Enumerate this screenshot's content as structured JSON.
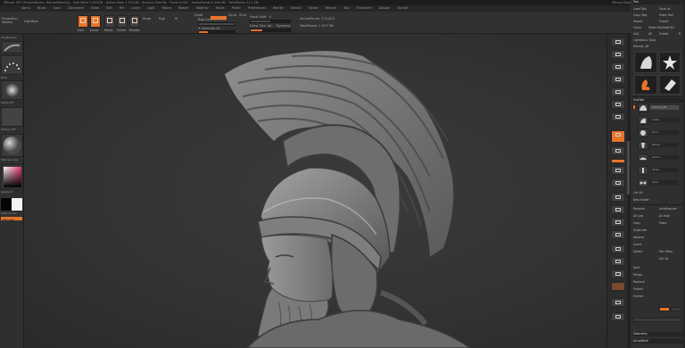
{
  "titlebar": {
    "text": "ZBrush 4R7 [ProjectName: HelmetWarrior] - Free Mem 2.453GB - Active Mem 1.512GB - Scratch Disk 96 - Timer 0.002 - ActivePoints 5.184 Mil - TotalPoints 11.2 Mil",
    "right_text": "Menus  DefaultZScript",
    "tag": "QuickSave"
  },
  "menubar": {
    "items": [
      "Alpha",
      "Brush",
      "Color",
      "Document",
      "Draw",
      "Edit",
      "File",
      "Layer",
      "Light",
      "Macro",
      "Marker",
      "Material",
      "Movie",
      "Picker",
      "Preferences",
      "Render",
      "Stencil",
      "Stroke",
      "Texture",
      "Tool",
      "Transform",
      "Zplugin",
      "Zscript"
    ]
  },
  "toolbar": {
    "projection_label": "Projection Master",
    "lightbox_label": "LightBox",
    "edit_label": "Edit",
    "draw_label": "Draw",
    "move_label": "Move",
    "scale_label": "Scale",
    "rotate_label": "Rotate",
    "mrgb_label": "Mrgb",
    "rgb_label": "Rgb",
    "m_label": "M",
    "zadd_label": "Zadd",
    "zsub_label": "Zsub",
    "zcut_label": "Zcut",
    "rgb_intensity_label": "Rgb Intensity",
    "rgb_intensity_value": "100",
    "z_intensity_label": "Z Intensity",
    "z_intensity_value": "25",
    "focal_shift_label": "Focal Shift",
    "focal_shift_value": "0",
    "draw_size_label": "Draw Size",
    "draw_size_value": "64",
    "dynamic_label": "Dynamic",
    "active_points_label": "ActivePoints: 172,614",
    "total_points_label": "TotalPoints: 1.027 Mil"
  },
  "lefttray": {
    "brush_label": "ClayBuildup",
    "stroke_label": "Dots",
    "alpha_label": "Alpha Off",
    "texture_label": "Texture Off",
    "material_label": "MatCap Gray",
    "gradient_label": "Gradient",
    "switch_label": "SwitchColor",
    "alternate_label": "Alternate"
  },
  "shelf": {
    "buttons": [
      "BPR",
      "SPix 3",
      "Scroll",
      "Zoom",
      "Actual",
      "AAHalf",
      "Dynamic",
      "Persp",
      "Floor",
      "Local",
      "LSym",
      "Gxyz",
      "Frame",
      "Move",
      "Scale",
      "Rotate",
      "Line Fill",
      "PolyF",
      "Transp",
      "Ghost",
      "Solo",
      "Xpose"
    ]
  },
  "palette": {
    "title": "Tool",
    "load_tool": "Load Tool",
    "save_as": "Save As",
    "copy_tool": "Copy Tool",
    "paste_tool": "Paste Tool",
    "import": "Import",
    "export": "Export",
    "clone": "Clone",
    "make_polymesh": "Make PolyMesh3D",
    "goz": "GoZ",
    "all": "All",
    "visible": "Visible",
    "r": "R",
    "lightbox_tools": "Lightbox ▸ Tools",
    "tool_name": "Helmet_48",
    "subtool_header": "SubTool",
    "subtool_items": [
      "Helmet_48",
      "Crest",
      "Face",
      "Beard",
      "Armor",
      "Strap",
      "Eyes"
    ],
    "list_all": "List All",
    "new_folder": "New Folder",
    "rename": "Rename",
    "auto_reorder": "AutoReorder",
    "all_low": "All Low",
    "all_high": "All High",
    "copy": "Copy",
    "paste": "Paste",
    "duplicate": "Duplicate",
    "append": "Append",
    "insert": "Insert",
    "delete": "Delete",
    "del_other": "Del Other",
    "del_all": "Del All",
    "split": "Split",
    "merge": "Merge",
    "remesh": "Remesh",
    "project": "Project",
    "extract": "Extract",
    "geometry": "Geometry",
    "arraymesh": "ArrayMesh"
  },
  "colors": {
    "accent": "#e8742b",
    "panel": "#2f2f2f",
    "canvas": "#333333",
    "sculpt": "#8a8a8a"
  }
}
